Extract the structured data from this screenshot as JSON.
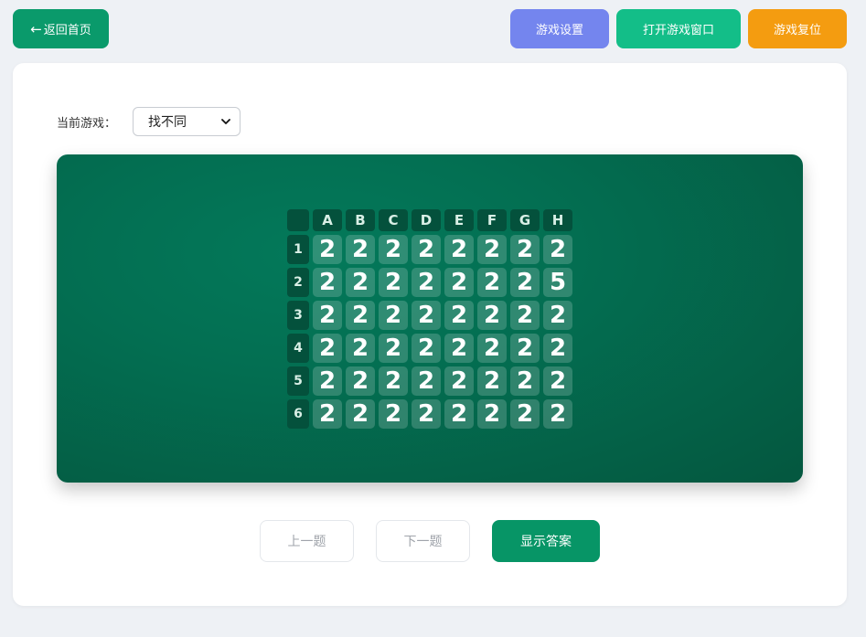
{
  "header": {
    "back_arrow": "←",
    "back_label": "返回首页",
    "settings_label": "游戏设置",
    "open_window_label": "打开游戏窗口",
    "reset_label": "游戏复位"
  },
  "game_selector": {
    "label": "当前游戏：",
    "selected": "找不同"
  },
  "grid": {
    "column_headers": [
      "A",
      "B",
      "C",
      "D",
      "E",
      "F",
      "G",
      "H"
    ],
    "row_headers": [
      "1",
      "2",
      "3",
      "4",
      "5",
      "6"
    ],
    "cells": [
      [
        "2",
        "2",
        "2",
        "2",
        "2",
        "2",
        "2",
        "2"
      ],
      [
        "2",
        "2",
        "2",
        "2",
        "2",
        "2",
        "2",
        "5"
      ],
      [
        "2",
        "2",
        "2",
        "2",
        "2",
        "2",
        "2",
        "2"
      ],
      [
        "2",
        "2",
        "2",
        "2",
        "2",
        "2",
        "2",
        "2"
      ],
      [
        "2",
        "2",
        "2",
        "2",
        "2",
        "2",
        "2",
        "2"
      ],
      [
        "2",
        "2",
        "2",
        "2",
        "2",
        "2",
        "2",
        "2"
      ]
    ]
  },
  "controls": {
    "prev_label": "上一题",
    "next_label": "下一题",
    "show_answer_label": "显示答案"
  },
  "colors": {
    "back": "#0a9a6b",
    "settings": "#7485ee",
    "open_window": "#13be88",
    "reset": "#f49c10",
    "board": "#03795a",
    "show_answer": "#079566"
  }
}
